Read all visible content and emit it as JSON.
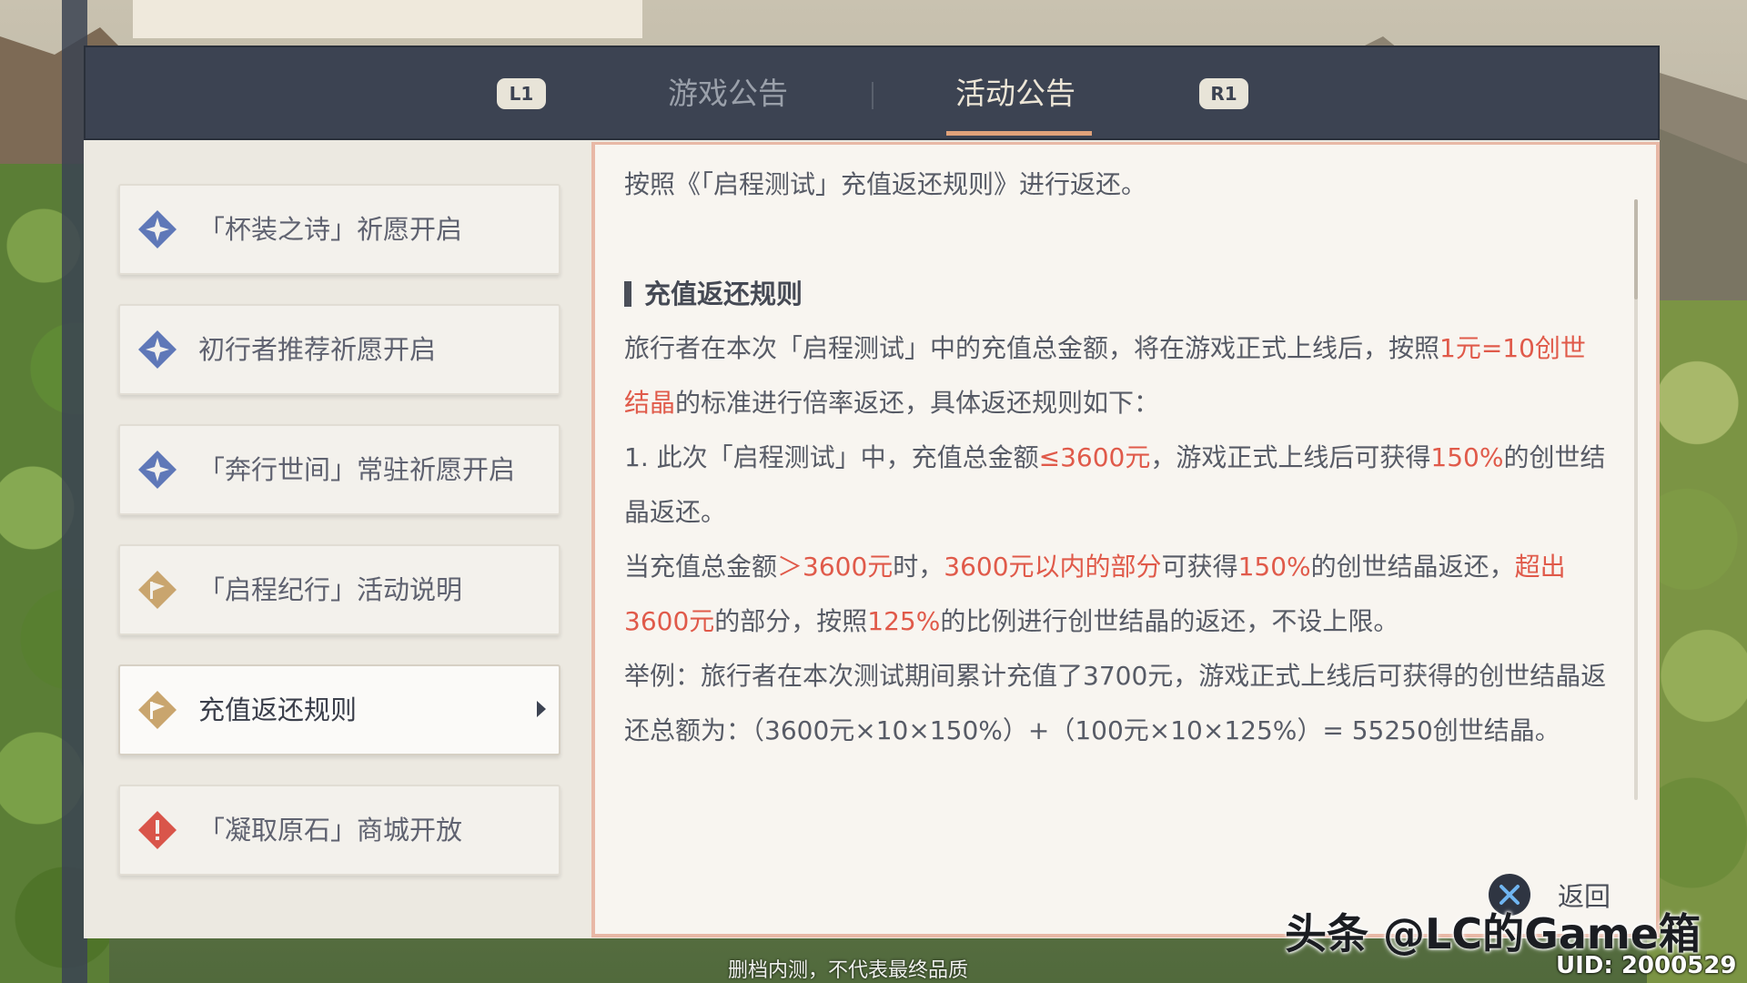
{
  "tabs": {
    "left_badge": "L1",
    "right_badge": "R1",
    "items": [
      {
        "label": "游戏公告",
        "active": false
      },
      {
        "label": "活动公告",
        "active": true
      }
    ]
  },
  "sidebar": {
    "items": [
      {
        "label": "「杯装之诗」祈愿开启",
        "icon": "blue-diamond-star-icon"
      },
      {
        "label": "初行者推荐祈愿开启",
        "icon": "blue-diamond-star-icon"
      },
      {
        "label": "「奔行世间」常驻祈愿开启",
        "icon": "blue-diamond-star-icon"
      },
      {
        "label": "「启程纪行」活动说明",
        "icon": "gold-diamond-flag-icon"
      },
      {
        "label": "充值返还规则",
        "icon": "gold-diamond-flag-icon",
        "selected": true
      },
      {
        "label": "「凝取原石」商城开放",
        "icon": "red-diamond-alert-icon"
      }
    ]
  },
  "content": {
    "intro": "按照《「启程测试」充值返还规则》进行返还。",
    "section_title": "充值返还规则",
    "p1": {
      "a": "旅行者在本次「启程测试」中的充值总金额，将在游戏正式上线后，按照",
      "b": "1元=10创世结晶",
      "c": "的标准进行倍率返还，具体返还规则如下："
    },
    "p2": {
      "a": "1. 此次「启程测试」中，充值总金额",
      "b": "≤3600元",
      "c": "，游戏正式上线后可获得",
      "d": "150%",
      "e": "的创世结晶返还。"
    },
    "p3": {
      "a": "当充值总金额",
      "b": "＞3600元",
      "c": "时，",
      "d": "3600元以内的部分",
      "e": "可获得",
      "f": "150%",
      "g": "的创世结晶返还，",
      "h": "超出3600元",
      "i": "的部分，按照",
      "j": "125%",
      "k": "的比例进行创世结晶的返还，不设上限。"
    },
    "p4": "举例：旅行者在本次测试期间累计充值了3700元，游戏正式上线后可获得的创世结晶返还总额为：（3600元×10×150%）+（100元×10×125%）= 55250创世结晶。"
  },
  "back_button": {
    "label": "返回",
    "icon": "cross-button-icon"
  },
  "overlay": {
    "watermark": "头条 @LC的Game箱",
    "uid": "UID: 2000529",
    "disclaimer": "删档内测，不代表最终品质"
  },
  "colors": {
    "highlight": "#e05a4a",
    "header_bg": "#3c4352",
    "accent_underline": "#e0a27a",
    "content_border": "#e8b8a6"
  }
}
